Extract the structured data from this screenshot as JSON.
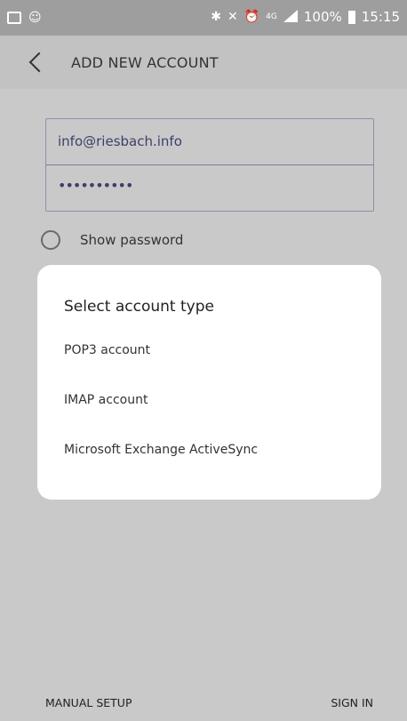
{
  "status_bar": {
    "network": "4G",
    "battery": "100%",
    "time": "15:15",
    "icons": [
      "gallery-icon",
      "smiley-icon",
      "bluetooth-icon",
      "mute-icon",
      "alarm-icon",
      "signal-icon",
      "battery-icon"
    ]
  },
  "header": {
    "title": "ADD NEW ACCOUNT",
    "back_icon": "chevron-left-icon"
  },
  "form": {
    "email_value": "info@riesbach.info",
    "password_value": "••••••••••",
    "show_password_label": "Show password"
  },
  "dialog": {
    "title": "Select account type",
    "options": [
      {
        "label": "POP3 account"
      },
      {
        "label": "IMAP account"
      },
      {
        "label": "Microsoft Exchange ActiveSync"
      }
    ]
  },
  "footer": {
    "manual_setup_label": "MANUAL SETUP",
    "sign_in_label": "SIGN IN"
  }
}
